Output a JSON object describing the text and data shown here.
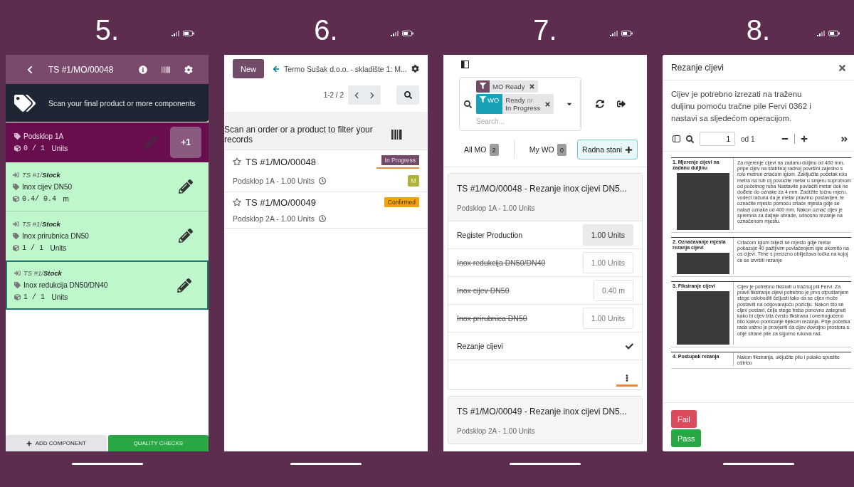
{
  "phones": [
    {
      "kind": "barcode",
      "step": "5.",
      "title": "TS #1/MO/00048",
      "banner": "Scan your final product or more components",
      "product": {
        "name": "Podsklop 1A",
        "quantity": "0 / 1",
        "unit": "Units",
        "add_button": "+1"
      },
      "lines": [
        {
          "location": "TS #1/**Stock**",
          "name": "Inox cijev DN50",
          "quantity": "0.4/ 0.4",
          "unit": "m",
          "selected": false
        },
        {
          "location": "TS #1/**Stock**",
          "name": "Inox prirubnica DN50",
          "quantity": "1 / 1",
          "unit": "Units",
          "selected": false
        },
        {
          "location": "TS #1/**Stock**",
          "name": "Inox redukcija DN50/DN40",
          "quantity": "1 / 1",
          "unit": "Units",
          "selected": true
        }
      ],
      "actions": [
        {
          "kind": "secondary",
          "label": "ADD COMPONENT"
        },
        {
          "kind": "primary",
          "label": "QUALITY CHECKS"
        }
      ]
    },
    {
      "kind": "list",
      "step": "6.",
      "new_button": "New",
      "breadcrumb": "Termo Sušak d.o.o. - skladište 1: M...",
      "pager": "1-2 / 2",
      "scan_hint": "Scan an order or a product to filter your records",
      "records": [
        {
          "reference": "TS #1/MO/00048",
          "status": "In Progress",
          "color": "#714b67",
          "detail": "Podsklop 1A - 1.00 Units",
          "assignee": "M",
          "focused": true
        },
        {
          "reference": "TS #1/MO/00049",
          "status": "Confirmed",
          "color": "#f0a30a",
          "detail": "Podsklop 2A - 1.00 Units",
          "focused": false
        }
      ]
    },
    {
      "kind": "shop_floor",
      "step": "7.",
      "facets": [
        {
          "values": [
            "MO Ready"
          ],
          "color": "#714b67"
        },
        {
          "label": "WO",
          "values": [
            "Ready",
            "In Progress"
          ],
          "separator": "or",
          "color": "#17a2b8"
        }
      ],
      "search": {
        "placeholder": "Search..."
      },
      "tabs": [
        {
          "label": "All MO",
          "count": "2",
          "selected": false
        },
        {
          "label": "My WO",
          "count": "0",
          "selected": false
        },
        {
          "label": "Radna stani",
          "selected": true
        }
      ],
      "cards": [
        {
          "title": "TS #1/MO/00048 - Rezanje inox cijevi DN5...",
          "subtitle": "Podsklop 1A - 1.00 Units",
          "menu_focused": true,
          "rows": [
            {
              "kind": "register",
              "label": "Register Production",
              "value": "1.00 Units"
            },
            {
              "kind": "component",
              "label": "Inox redukcija DN50/DN40",
              "value": "1.00 Units",
              "done": true
            },
            {
              "kind": "component",
              "label": "Inox cijev DN50",
              "value": "0.40 m",
              "done": true
            },
            {
              "kind": "component",
              "label": "Inox prirubnica DN50",
              "value": "1.00 Units",
              "done": true
            },
            {
              "kind": "step",
              "label": "Rezanje cijevi",
              "done": true
            }
          ]
        },
        {
          "title": "TS #1/MO/00049 - Rezanje inox cijevi DN5...",
          "subtitle": "Podsklop 2A - 1.00 Units"
        }
      ]
    },
    {
      "kind": "dialog",
      "step": "8.",
      "title": "Rezanje cijevi",
      "instructions": "Cijev je potrebno izrezati na traženu duljinu pomoću tračne pile Fervi 0362 i nastavi sa sljedećom operacijom.",
      "viewer": {
        "page": "1",
        "page_count": "od 1"
      },
      "document": [
        {
          "heading": "1.   Mjerenje cijevi na zadanu duljinu",
          "photo": true,
          "text": "Za mjerenje cijevi na zadanu duljinu od 400 mm, pripe cijev na stabilnoj radnoj površini zajedno s rolo metron crtaćom iglom. Zaključite početak rolo metra na rub cij povucite metar u smjeru suprotnom od početnog ruba Nastavite povlačiti metar dok ne dođete do oznake za 4 mm. Zadržite točnu mjeru, vodeći računa da je metar pravilno postavljen, te označite mjesto pomoću crtaće mjesta gdje se nalazi oznaka od 400 mm. Nakon označ cijev je spremna za daljnje obrade, odnosno rezanje na označenom mjestu."
        },
        {
          "heading": "2.   Označavanje mjesta rezanja cijevi",
          "photo": true,
          "text": "Crtaćom iglom bilježi se mjesto gdje metar pokazuje 40 pažljivim povlačenjem igle okomito na os cijevi. Time s precizno obilježava točka na kojoj će se izvršiti rezanje"
        },
        {
          "heading": "3.   Fiksiranje cijevi",
          "photo": true,
          "text": "Cijev je potrebno fiksirati u tračnoj pili Fervi. Za pravil fiksiranje cijevi potrebno je prvo otpuštanjem stege osloboditi čeljusti tako da se cijev može postaviti na odgovarajuću poziciju. Nakon što se cijev postavi, čelju stege treba ponovno zategnuti kako bi cijev bila čvrsto fiksirana i onemogućeno bilo kakvo pomicanje tijekom rezanja. Prije početka rada važno je provjeriti da cijev dovoljno prostora s obje strane pile za sigurno rukova rad."
        },
        {
          "heading": "4.   Postupak rezanja",
          "photo": false,
          "text": "Nakon fiksiranja, uključite pilu i polako spustite oštricu"
        }
      ],
      "buttons": [
        {
          "kind": "fail",
          "label": "Fail"
        },
        {
          "kind": "pass",
          "label": "Pass"
        }
      ]
    }
  ]
}
